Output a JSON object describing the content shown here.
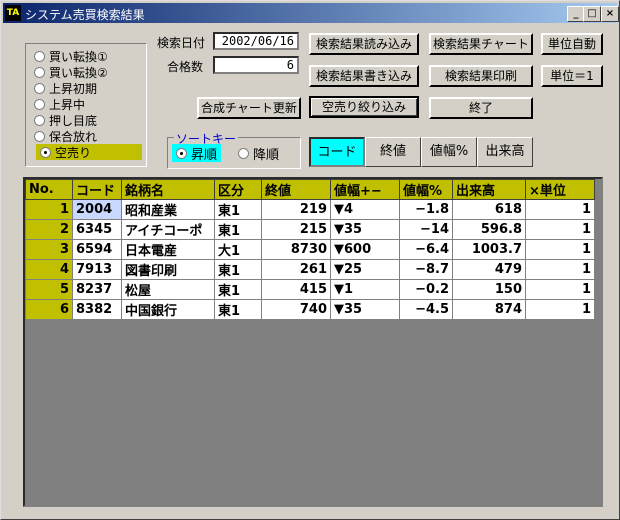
{
  "window": {
    "title": "システム売買検索結果",
    "icon": "app-icon",
    "min": "_",
    "max": "□",
    "close": "×"
  },
  "strategies": [
    {
      "label": "買い転換①",
      "selected": false
    },
    {
      "label": "買い転換②",
      "selected": false
    },
    {
      "label": "上昇初期",
      "selected": false
    },
    {
      "label": "上昇中",
      "selected": false
    },
    {
      "label": "押し目底",
      "selected": false
    },
    {
      "label": "保合放れ",
      "selected": false
    },
    {
      "label": "空売り",
      "selected": true
    }
  ],
  "search": {
    "date_label": "検索日付",
    "date_value": "2002/06/16",
    "count_label": "合格数",
    "count_value": "6"
  },
  "buttons": {
    "load": "検索結果読み込み",
    "chart": "検索結果チャート",
    "auto_unit": "単位自動",
    "save": "検索結果書き込み",
    "print": "検索結果印刷",
    "unit_one": "単位＝1",
    "combined_chart": "合成チャート更新",
    "filter_short": "空売り絞り込み",
    "exit": "終了"
  },
  "sort": {
    "legend": "ソートキー",
    "asc": "昇順",
    "desc": "降順",
    "keys": [
      "コード",
      "終値",
      "値幅%",
      "出来高"
    ],
    "active_key": "コード"
  },
  "table": {
    "headers": [
      "No.",
      "コード",
      "銘柄名",
      "区分",
      "終値",
      "値幅+−",
      "値幅%",
      "出来高",
      "×単位"
    ],
    "rows": [
      [
        "1",
        "2004",
        "昭和産業",
        "東1",
        "219",
        "▼4",
        "−1.8",
        "618",
        "1"
      ],
      [
        "2",
        "6345",
        "アイチコーポ",
        "東1",
        "215",
        "▼35",
        "−14",
        "596.8",
        "1"
      ],
      [
        "3",
        "6594",
        "日本電産",
        "大1",
        "8730",
        "▼600",
        "−6.4",
        "1003.7",
        "1"
      ],
      [
        "4",
        "7913",
        "図書印刷",
        "東1",
        "261",
        "▼25",
        "−8.7",
        "479",
        "1"
      ],
      [
        "5",
        "8237",
        "松屋",
        "東1",
        "415",
        "▼1",
        "−0.2",
        "150",
        "1"
      ],
      [
        "6",
        "8382",
        "中国銀行",
        "東1",
        "740",
        "▼35",
        "−4.5",
        "874",
        "1"
      ]
    ]
  },
  "colors": {
    "accent": "#c0c000",
    "sort_active": "#00ffff",
    "title_bar": "#0a246a"
  }
}
